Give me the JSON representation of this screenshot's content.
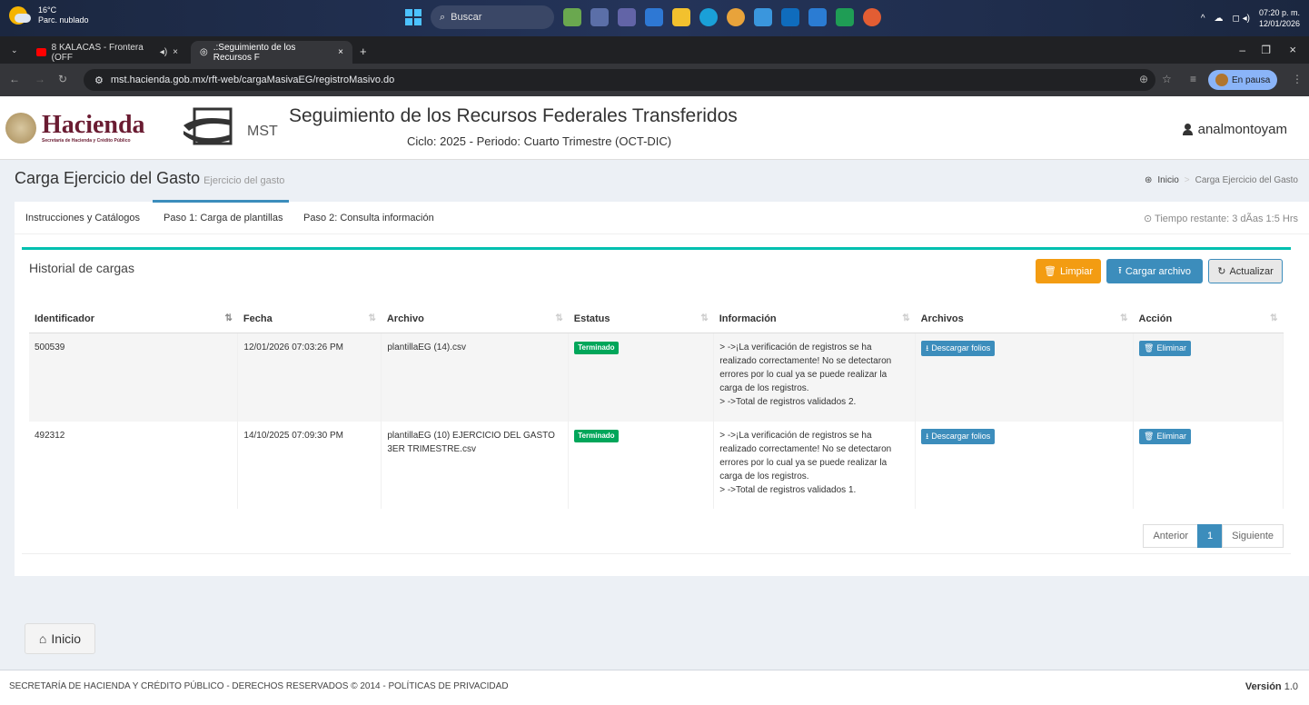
{
  "taskbar": {
    "weather_temp": "16°C",
    "weather_desc": "Parc. nublado",
    "search_label": "Buscar",
    "time": "07:20 p. m.",
    "date": "12/01/2026"
  },
  "browser": {
    "tab1": "8 KALACAS - Frontera (OFF",
    "tab2": ".:Seguimiento de los Recursos F",
    "url": "mst.hacienda.gob.mx/rft-web/cargaMasivaEG/registroMasivo.do",
    "profile_label": "En pausa"
  },
  "header": {
    "logo_big": "Hacienda",
    "logo_small": "Secretaría de Hacienda y Crédito Público",
    "mst_label": "MST",
    "title": "Seguimiento de los Recursos Federales Transferidos",
    "subtitle": "Ciclo: 2025 - Periodo: Cuarto Trimestre (OCT-DIC)",
    "user": "analmontoyam"
  },
  "page": {
    "title": "Carga Ejercicio del Gasto",
    "subtitle": "Ejercicio del gasto",
    "breadcrumb_home": "Inicio",
    "breadcrumb_current": "Carga Ejercicio del Gasto"
  },
  "tabs": {
    "t1": "Instrucciones y Catálogos",
    "t2": "Paso 1: Carga de plantillas",
    "t3": "Paso 2: Consulta información",
    "time_left": "Tiempo restante: 3 dÃas 1:5 Hrs"
  },
  "panel": {
    "title": "Historial de cargas",
    "btn_clear": "Limpiar",
    "btn_upload": "Cargar archivo",
    "btn_refresh": "Actualizar"
  },
  "table": {
    "headers": [
      "Identificador",
      "Fecha",
      "Archivo",
      "Estatus",
      "Información",
      "Archivos",
      "Acción"
    ],
    "rows": [
      {
        "id": "500539",
        "date": "12/01/2026 07:03:26 PM",
        "file": "plantillaEG (14).csv",
        "status": "Terminado",
        "info1": "> ->¡La verificación de registros se ha realizado correctamente! No se detectaron errores por lo cual ya se puede realizar la carga de los registros.",
        "info2": "> ->Total de registros validados 2.",
        "download": "Descargar folios",
        "action": "Eliminar"
      },
      {
        "id": "492312",
        "date": "14/10/2025 07:09:30 PM",
        "file": "plantillaEG (10) EJERCICIO DEL GASTO 3ER TRIMESTRE.csv",
        "status": "Terminado",
        "info1": "> ->¡La verificación de registros se ha realizado correctamente! No se detectaron errores por lo cual ya se puede realizar la carga de los registros.",
        "info2": "> ->Total de registros validados 1.",
        "download": "Descargar folios",
        "action": "Eliminar"
      }
    ]
  },
  "pager": {
    "prev": "Anterior",
    "page": "1",
    "next": "Siguiente"
  },
  "home_button": "Inicio",
  "footer": {
    "left": "SECRETARÍA DE HACIENDA Y CRÉDITO PÚBLICO - DERECHOS RESERVADOS © 2014 - POLÍTICAS DE PRIVACIDAD",
    "version_label": "Versión",
    "version": "1.0"
  },
  "colors": {
    "accent": "#3c8dbc",
    "warning": "#f39c12",
    "success": "#00a65a",
    "teal": "#00c0b0",
    "brand": "#6a1c32"
  }
}
